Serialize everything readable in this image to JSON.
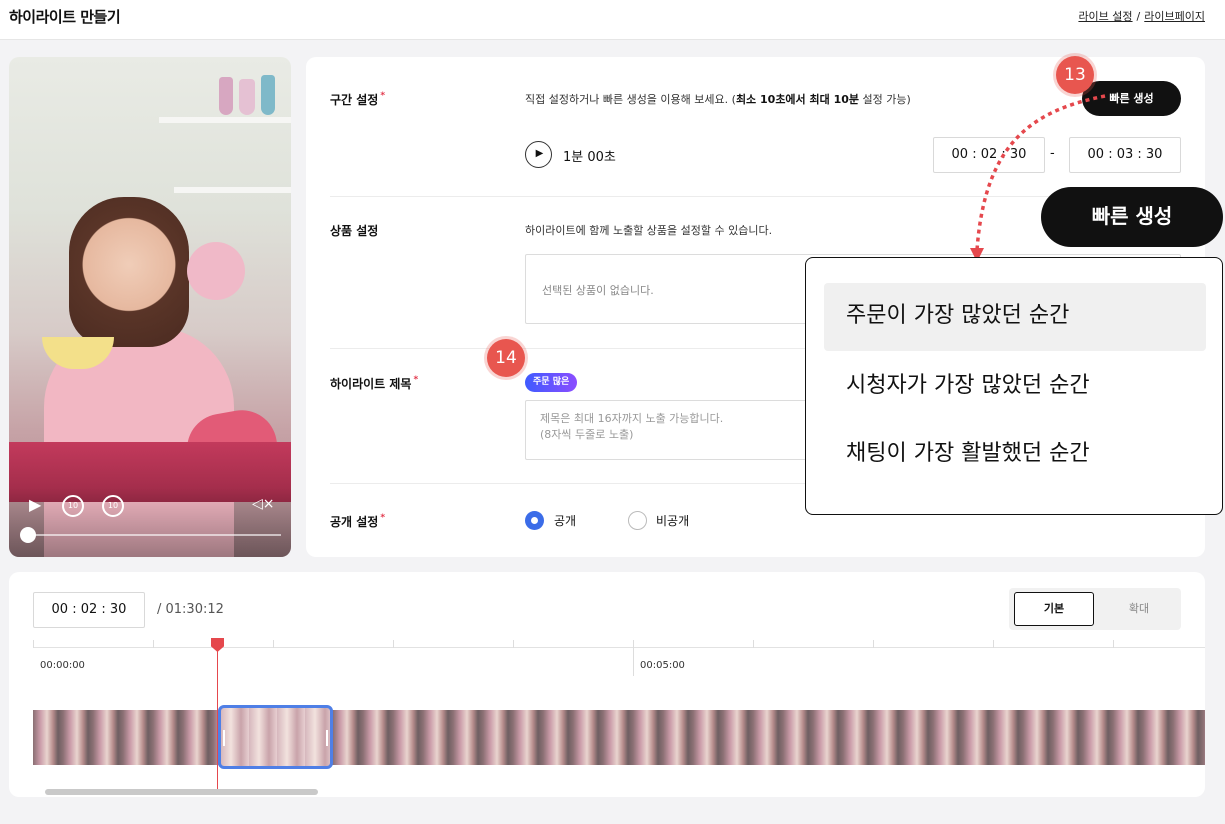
{
  "header": {
    "title": "하이라이트 만들기",
    "breadcrumb_live_settings": "라이브 설정",
    "breadcrumb_sep": "/",
    "breadcrumb_live_page": "라이브페이지"
  },
  "video": {
    "rewind_label": "10",
    "forward_label": "10",
    "progress": 0.0
  },
  "section": {
    "label": "구간 설정",
    "desc_prefix": "직접 설정하거나 빠른 생성을 이용해 보세요. (",
    "desc_bold": "최소 10초에서 최대 10분",
    "desc_suffix": " 설정 가능)",
    "quick_button": "빠른 생성",
    "duration": "1분 00초",
    "start_time": "00 : 02 : 30",
    "dash": "-",
    "end_time": "00 : 03 : 30"
  },
  "product": {
    "label": "상품 설정",
    "desc": "하이라이트에 함께 노출할 상품을 설정할 수 있습니다.",
    "empty": "선택된 상품이 없습니다."
  },
  "highlight_title": {
    "label": "하이라이트 제목",
    "tag": "주문 많은",
    "placeholder_line1": "제목은 최대 16자까지 노출 가능합니다.",
    "placeholder_line2": "(8자씩 두줄로 노출)"
  },
  "visibility": {
    "label": "공개 설정",
    "public": "공개",
    "private": "비공개",
    "selected": "공개"
  },
  "required_mark": "*",
  "annotations": {
    "badge_13": "13",
    "badge_14": "14",
    "callout": "빠른 생성"
  },
  "quick_menu": {
    "items": [
      "주문이 가장 많았던 순간",
      "시청자가 가장 많았던 순간",
      "채팅이 가장 활발했던 순간"
    ]
  },
  "timeline": {
    "current_time": "00 : 02 : 30",
    "total_time": "/  01:30:12",
    "mode_basic": "기본",
    "mode_zoom": "확대",
    "label_start": "00:00:00",
    "label_mid": "00:05:00"
  },
  "colors": {
    "accent_blue": "#3b6ce8",
    "required_red": "#e2384c",
    "playhead_red": "#e5484d",
    "badge_red": "#e8564f"
  }
}
